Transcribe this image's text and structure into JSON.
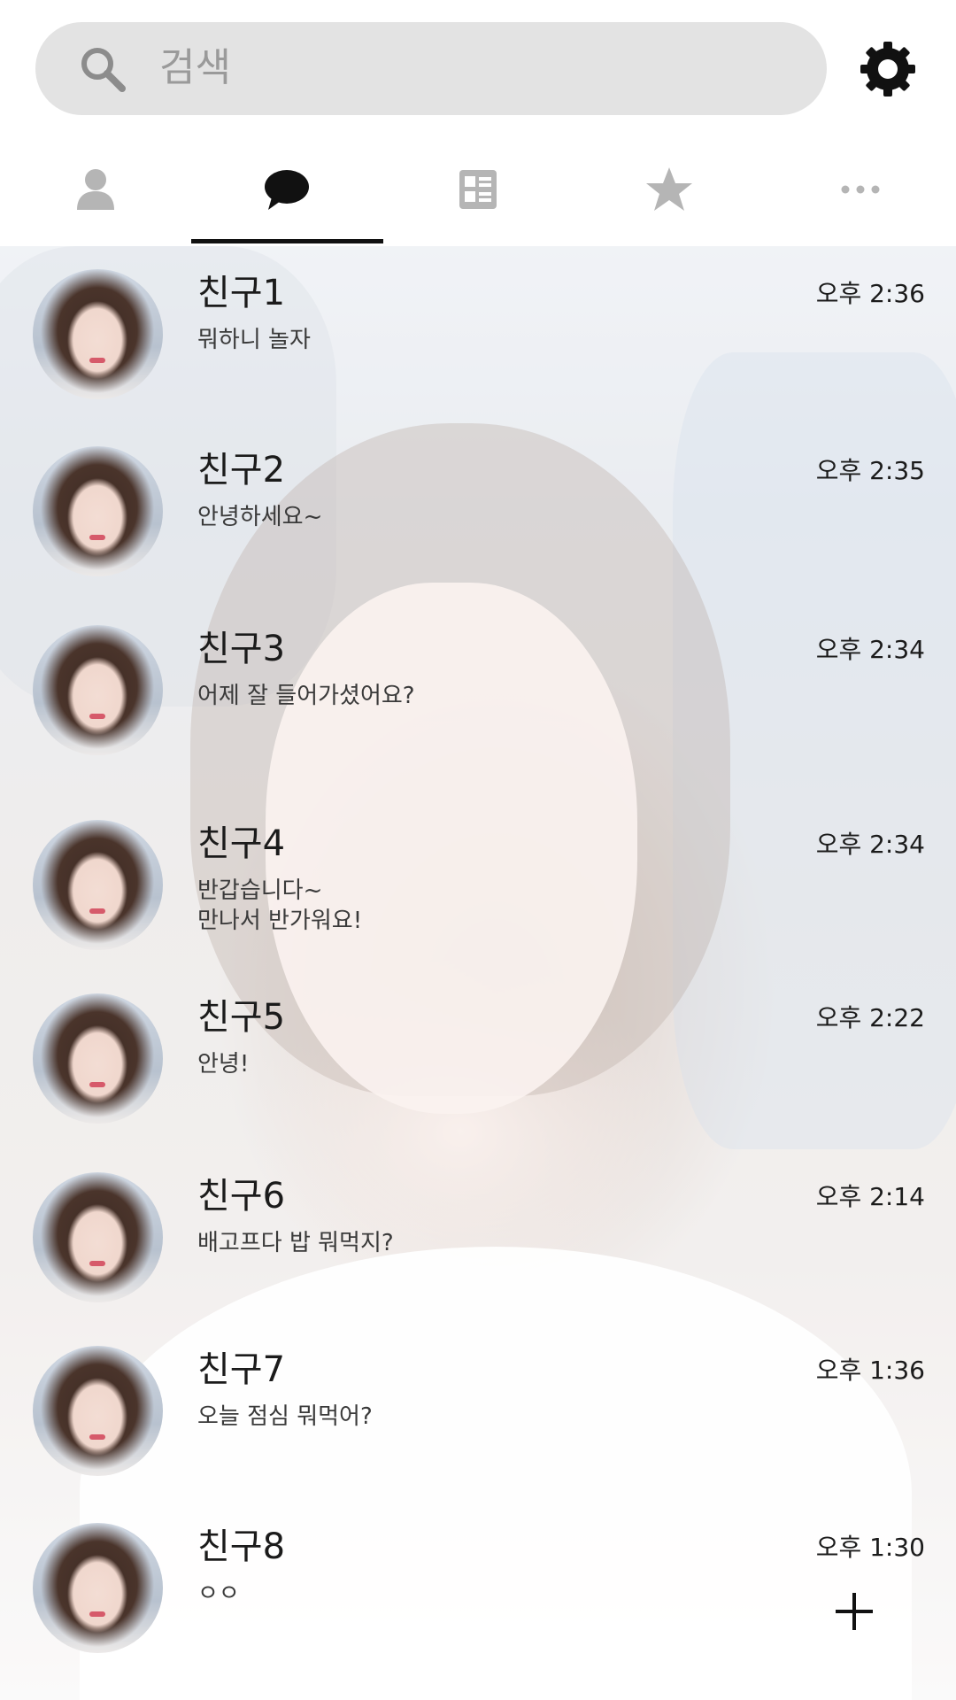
{
  "search": {
    "placeholder": "검색"
  },
  "tabs": [
    {
      "id": "friends",
      "icon": "person-icon",
      "active": false
    },
    {
      "id": "chats",
      "icon": "chat-bubble-icon",
      "active": true
    },
    {
      "id": "news",
      "icon": "list-icon",
      "active": false
    },
    {
      "id": "favorites",
      "icon": "star-icon",
      "active": false
    },
    {
      "id": "more",
      "icon": "more-icon",
      "active": false
    }
  ],
  "chats": [
    {
      "name": "친구1",
      "message": "뭐하니 놀자",
      "time": "오후 2:36"
    },
    {
      "name": "친구2",
      "message": "안녕하세요~",
      "time": "오후 2:35"
    },
    {
      "name": "친구3",
      "message": "어제 잘 들어가셨어요?",
      "time": "오후 2:34"
    },
    {
      "name": "친구4",
      "message": "반갑습니다~\n만나서 반가워요!",
      "time": "오후 2:34"
    },
    {
      "name": "친구5",
      "message": "안녕!",
      "time": "오후 2:22"
    },
    {
      "name": "친구6",
      "message": "배고프다 밥 뭐먹지?",
      "time": "오후 2:14"
    },
    {
      "name": "친구7",
      "message": "오늘 점심 뭐먹어?",
      "time": "오후 1:36"
    },
    {
      "name": "친구8",
      "message": "ㅇㅇ",
      "time": "오후 1:30"
    }
  ],
  "colors": {
    "accent": "#111111",
    "search_bg": "#e3e3e3",
    "inactive_icon": "#b5b5b5"
  }
}
